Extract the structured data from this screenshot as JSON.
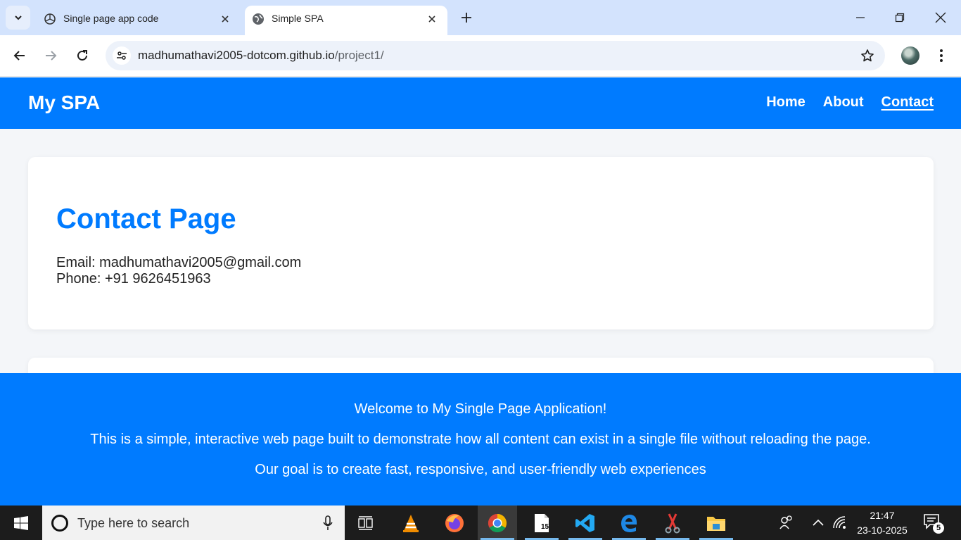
{
  "browser": {
    "tabs": [
      {
        "title": "Single page app code",
        "icon": "openai-icon",
        "active": false
      },
      {
        "title": "Simple SPA",
        "icon": "globe-icon",
        "active": true
      }
    ],
    "url_host": "madhumathavi2005-dotcom.github.io",
    "url_path": "/project1/"
  },
  "page": {
    "brand": "My SPA",
    "nav": [
      {
        "label": "Home"
      },
      {
        "label": "About"
      },
      {
        "label": "Contact",
        "current": true
      }
    ],
    "content": {
      "heading": "Contact Page",
      "email_line": "Email: madhumathavi2005@gmail.com",
      "phone_line": "Phone: +91 9626451963"
    },
    "footer": {
      "line1": "Welcome to My Single Page Application!",
      "line2": "This is a simple, interactive web page built to demonstrate how all content can exist in a single file without reloading the page.",
      "line3": "Our goal is to create fast, responsive, and user-friendly web experiences"
    },
    "colors": {
      "primary": "#007bff",
      "background": "#f4f6f9",
      "card": "#ffffff"
    }
  },
  "taskbar": {
    "search_placeholder": "Type here to search",
    "time": "21:47",
    "date": "23-10-2025",
    "notification_count": "5",
    "file_icon_badge": "15",
    "apps": [
      "task-view-icon",
      "vlc-icon",
      "firefox-icon",
      "chrome-icon",
      "notepad-icon",
      "vscode-icon",
      "edge-icon",
      "snipping-tool-icon",
      "file-explorer-icon"
    ]
  }
}
